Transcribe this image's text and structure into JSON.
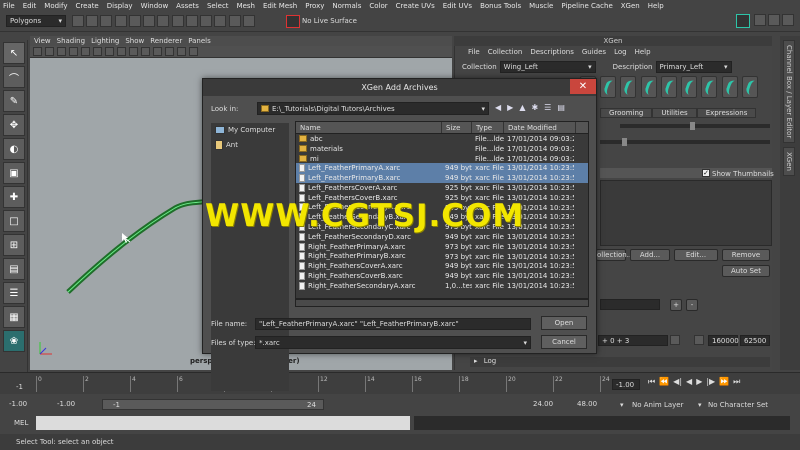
{
  "menubar": [
    "File",
    "Edit",
    "Modify",
    "Create",
    "Display",
    "Window",
    "Assets",
    "Select",
    "Mesh",
    "Edit Mesh",
    "Proxy",
    "Normals",
    "Color",
    "Create UVs",
    "Edit UVs",
    "Bonus Tools",
    "Muscle",
    "Pipeline Cache",
    "XGen",
    "Help"
  ],
  "toolbar": {
    "mode_combo": "Polygons",
    "live_surface": "No Live Surface"
  },
  "viewport": {
    "menu": [
      "View",
      "Shading",
      "Lighting",
      "Show",
      "Renderer",
      "Panels"
    ],
    "camera_label": "persp (defaultRenderLayer)"
  },
  "xgen": {
    "title": "XGen",
    "menu": [
      "File",
      "Collection",
      "Descriptions",
      "Guides",
      "Log",
      "Help"
    ],
    "collection_label": "Collection",
    "collection_value": "Wing_Left",
    "description_label": "Description",
    "description_value": "Primary_Left",
    "tabs": [
      "Grooming",
      "Utilities",
      "Expressions"
    ],
    "show_thumbnails": "Show Thumbnails",
    "buttons": {
      "collection": "ollection...",
      "add": "Add...",
      "edit": "Edit...",
      "remove": "Remove",
      "auto_set": "Auto Set"
    },
    "plus": "+",
    "minus": "-",
    "expr": "+ 0 + 3",
    "field_a": "160000",
    "field_b": "62500",
    "log_label": "Log"
  },
  "side_tabs": [
    "Channel Box / Layer Editor",
    "XGen"
  ],
  "timeline": {
    "start": "-1",
    "end": "-1.00",
    "ticks": [
      "0",
      "2",
      "4",
      "6",
      "8",
      "10",
      "12",
      "14",
      "16",
      "18",
      "20",
      "22",
      "24"
    ]
  },
  "range": {
    "start1": "-1.00",
    "start2": "-1.00",
    "slider_start": "-1",
    "slider_end": "24",
    "end1": "24.00",
    "end2": "48.00",
    "anim_layer": "No Anim Layer",
    "char_set": "No Character Set"
  },
  "mel": {
    "label": "MEL"
  },
  "status": "Select Tool: select an object",
  "dialog": {
    "title": "XGen Add Archives",
    "close": "✕",
    "look_in_label": "Look in:",
    "look_in_value": "E:\\_Tutorials\\Digital Tutors\\Archives",
    "places": [
      "My Computer",
      "Ant"
    ],
    "columns": [
      "Name",
      "Size",
      "Type",
      "Date Modified"
    ],
    "files": [
      {
        "name": "abc",
        "size": "",
        "type": "File...lder",
        "date": "17/01/2014 09:03:28",
        "kind": "folder",
        "selected": false
      },
      {
        "name": "materials",
        "size": "",
        "type": "File...lder",
        "date": "17/01/2014 09:03:28",
        "kind": "folder",
        "selected": false
      },
      {
        "name": "mi",
        "size": "",
        "type": "File...lder",
        "date": "17/01/2014 09:03:28",
        "kind": "folder",
        "selected": false
      },
      {
        "name": "Left_FeatherPrimaryA.xarc",
        "size": "949 bytes",
        "type": "xarc File",
        "date": "13/01/2014 10:23:54",
        "kind": "file",
        "selected": true
      },
      {
        "name": "Left_FeatherPrimaryB.xarc",
        "size": "949 bytes",
        "type": "xarc File",
        "date": "13/01/2014 10:23:54",
        "kind": "file",
        "selected": true
      },
      {
        "name": "Left_FeathersCoverA.xarc",
        "size": "925 bytes",
        "type": "xarc File",
        "date": "13/01/2014 10:23:54",
        "kind": "file",
        "selected": false
      },
      {
        "name": "Left_FeathersCoverB.xarc",
        "size": "925 bytes",
        "type": "xarc File",
        "date": "13/01/2014 10:23:54",
        "kind": "file",
        "selected": false
      },
      {
        "name": "Left_FeatherSecondaryA.xarc",
        "size": "949 bytes",
        "type": "xarc File",
        "date": "13/01/2014 10:23:54",
        "kind": "file",
        "selected": false
      },
      {
        "name": "Left_FeatherSecondaryB.xarc",
        "size": "949 bytes",
        "type": "xarc File",
        "date": "13/01/2014 10:23:54",
        "kind": "file",
        "selected": false
      },
      {
        "name": "Left_FeatherSecondaryC.xarc",
        "size": "973 bytes",
        "type": "xarc File",
        "date": "13/01/2014 10:23:54",
        "kind": "file",
        "selected": false
      },
      {
        "name": "Left_FeatherSecondaryD.xarc",
        "size": "949 bytes",
        "type": "xarc File",
        "date": "13/01/2014 10:23:54",
        "kind": "file",
        "selected": false
      },
      {
        "name": "Right_FeatherPrimaryA.xarc",
        "size": "973 bytes",
        "type": "xarc File",
        "date": "13/01/2014 10:23:54",
        "kind": "file",
        "selected": false
      },
      {
        "name": "Right_FeatherPrimaryB.xarc",
        "size": "973 bytes",
        "type": "xarc File",
        "date": "13/01/2014 10:23:54",
        "kind": "file",
        "selected": false
      },
      {
        "name": "Right_FeathersCoverA.xarc",
        "size": "949 bytes",
        "type": "xarc File",
        "date": "13/01/2014 10:23:54",
        "kind": "file",
        "selected": false
      },
      {
        "name": "Right_FeathersCoverB.xarc",
        "size": "949 bytes",
        "type": "xarc File",
        "date": "13/01/2014 10:23:54",
        "kind": "file",
        "selected": false
      },
      {
        "name": "Right_FeatherSecondaryA.xarc",
        "size": "1,0...tes",
        "type": "xarc File",
        "date": "13/01/2014 10:23:54",
        "kind": "file",
        "selected": false
      }
    ],
    "file_name_label": "File name:",
    "file_name_value": "\"Left_FeatherPrimaryA.xarc\" \"Left_FeatherPrimaryB.xarc\"",
    "file_type_label": "Files of type:",
    "file_type_value": "*.xarc",
    "open": "Open",
    "cancel": "Cancel"
  },
  "watermark": "WWW.CGTSJ.COM",
  "colors": {
    "accent_teal": "#2ec4a8",
    "selection_blue": "#5d7fa8",
    "watermark": "#f2e600",
    "close_red": "#c9463d"
  }
}
